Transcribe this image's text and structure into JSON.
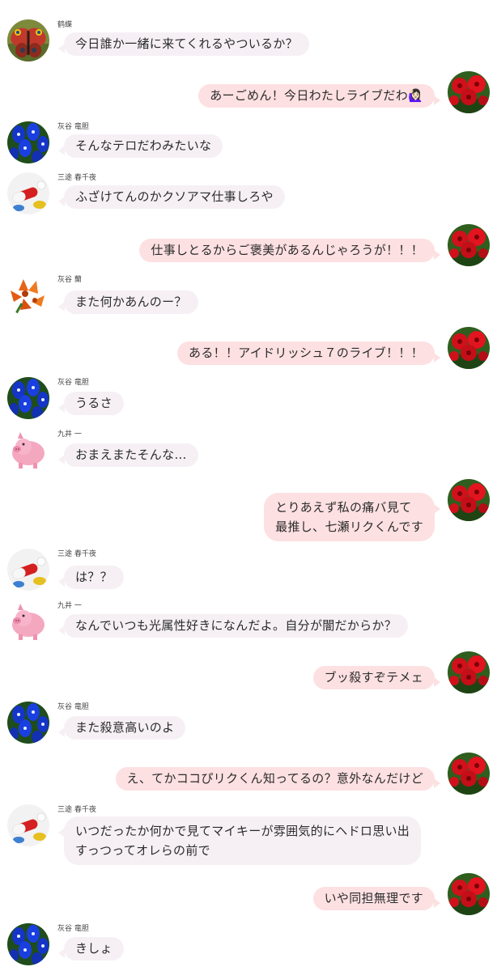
{
  "messages": [
    {
      "side": "in",
      "avatar": "butterfly",
      "sender": "鹤蝶",
      "text": "今日誰か一緒に来てくれるやついるか？"
    },
    {
      "side": "out",
      "avatar": "red-flowers",
      "sender": "",
      "text": "あーごめん！今日わたしライブだわ🙋🏻‍♀️"
    },
    {
      "side": "in",
      "avatar": "blue-flowers",
      "sender": "灰谷 竜胆",
      "text": "そんなテロだわみたいな"
    },
    {
      "side": "in",
      "avatar": "pills",
      "sender": "三途 春千夜",
      "text": "ふざけてんのかクソアマ仕事しろや"
    },
    {
      "side": "out",
      "avatar": "red-flowers",
      "sender": "",
      "text": "仕事しとるからご褒美があるんじゃろうが！！！"
    },
    {
      "side": "in",
      "avatar": "orange-lilies",
      "sender": "灰谷 蘭",
      "text": "また何かあんのー？"
    },
    {
      "side": "out",
      "avatar": "red-flowers",
      "sender": "",
      "text": "ある！！アイドリッシュ７のライブ！！！"
    },
    {
      "side": "in",
      "avatar": "blue-flowers",
      "sender": "灰谷 竜胆",
      "text": "うるさ"
    },
    {
      "side": "in",
      "avatar": "pig",
      "sender": "九井 一",
      "text": "おまえまたそんな…"
    },
    {
      "side": "out",
      "avatar": "red-flowers",
      "sender": "",
      "text": "とりあえず私の痛バ見て\n最推し、七瀬リクくんです"
    },
    {
      "side": "in",
      "avatar": "pills",
      "sender": "三途 春千夜",
      "text": "は？？"
    },
    {
      "side": "in",
      "avatar": "pig",
      "sender": "九井 一",
      "text": "なんでいつも光属性好きになんだよ。自分が闇だからか？"
    },
    {
      "side": "out",
      "avatar": "red-flowers",
      "sender": "",
      "text": "ブッ殺すぞテメェ"
    },
    {
      "side": "in",
      "avatar": "blue-flowers",
      "sender": "灰谷 竜胆",
      "text": "また殺意高いのよ"
    },
    {
      "side": "out",
      "avatar": "red-flowers",
      "sender": "",
      "text": "え、てかココぴリクくん知ってるの？意外なんだけど"
    },
    {
      "side": "in",
      "avatar": "pills",
      "sender": "三途 春千夜",
      "text": "いつだったか何かで見てマイキーが雰囲気的にヘドロ思い出\nすっつってオレらの前で"
    },
    {
      "side": "out",
      "avatar": "red-flowers",
      "sender": "",
      "text": "いや同担無理です"
    },
    {
      "side": "in",
      "avatar": "blue-flowers",
      "sender": "灰谷 竜胆",
      "text": "きしょ"
    }
  ]
}
